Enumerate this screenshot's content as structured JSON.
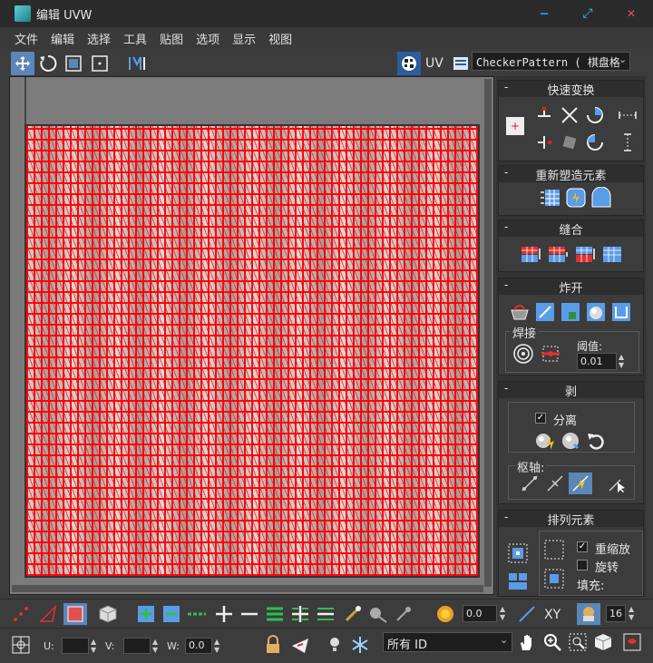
{
  "window": {
    "title": "编辑 UVW",
    "minimize": "‒",
    "restore": "⤢",
    "close": "✕"
  },
  "menu": [
    "文件",
    "编辑",
    "选择",
    "工具",
    "贴图",
    "选项",
    "显示",
    "视图"
  ],
  "toolbar": {
    "uv_label": "UV",
    "map_select_value": "CheckerPattern  ( 棋盘格"
  },
  "panels": {
    "quick_transform": {
      "title": "快速变换"
    },
    "reshape": {
      "title": "重新塑造元素"
    },
    "stitch": {
      "title": "缝合"
    },
    "explode": {
      "title": "炸开",
      "weld_label": "焊接",
      "threshold_label": "阈值:",
      "threshold_value": "0.01"
    },
    "peel": {
      "title": "剥",
      "detach_label": "分离",
      "detach_checked": true,
      "pivot_label": "枢轴:"
    },
    "arrange": {
      "title": "排列元素",
      "rescale_label": "重缩放",
      "rescale_checked": true,
      "rotate_label": "旋转",
      "rotate_checked": false,
      "padding_label": "填充:"
    }
  },
  "bottom": {
    "soft_value": "0.0",
    "xy_label": "XY",
    "grid_value": "16",
    "u_label": "U:",
    "v_label": "V:",
    "w_label": "W:",
    "w_value": "0.0",
    "id_select": "所有 ID"
  },
  "colors": {
    "accent": "#5b86b8",
    "uv_red": "#ff0000",
    "background": "#3c3c3c"
  }
}
